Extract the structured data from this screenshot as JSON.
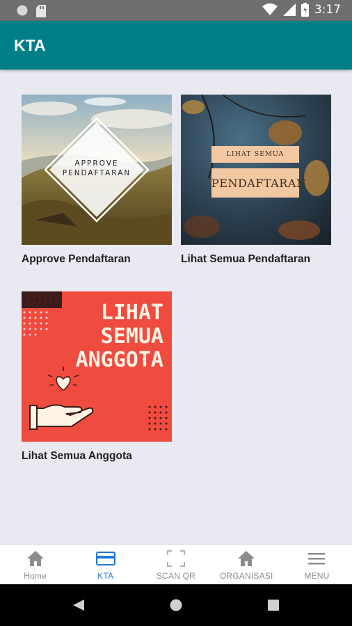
{
  "status_bar": {
    "time": "3:17"
  },
  "app_bar": {
    "title": "KTA"
  },
  "cards": [
    {
      "label": "Approve Pendaftaran",
      "image_text": [
        "APPROVE",
        "PENDAFTARAN"
      ]
    },
    {
      "label": "Lihat Semua Pendaftaran",
      "image_text": [
        "LIHAT SEMUA",
        "PENDAFTARAN"
      ]
    },
    {
      "label": "Lihat Semua Anggota",
      "image_text": [
        "LIHAT",
        "SEMUA",
        "ANGGOTA"
      ]
    }
  ],
  "bottom_nav": {
    "active": "KTA",
    "items": [
      {
        "label": "Home",
        "icon": "home-icon"
      },
      {
        "label": "KTA",
        "icon": "card-icon"
      },
      {
        "label": "SCAN QR",
        "icon": "scan-icon"
      },
      {
        "label": "ORGANISASI",
        "icon": "organization-icon"
      },
      {
        "label": "MENU",
        "icon": "menu-icon"
      }
    ]
  },
  "colors": {
    "app_bar": "#007f88",
    "background": "#e9e9f1",
    "active_nav": "#1e78d2",
    "inactive_nav": "#8c8c8c",
    "anggota_card": "#ef4b3f"
  }
}
